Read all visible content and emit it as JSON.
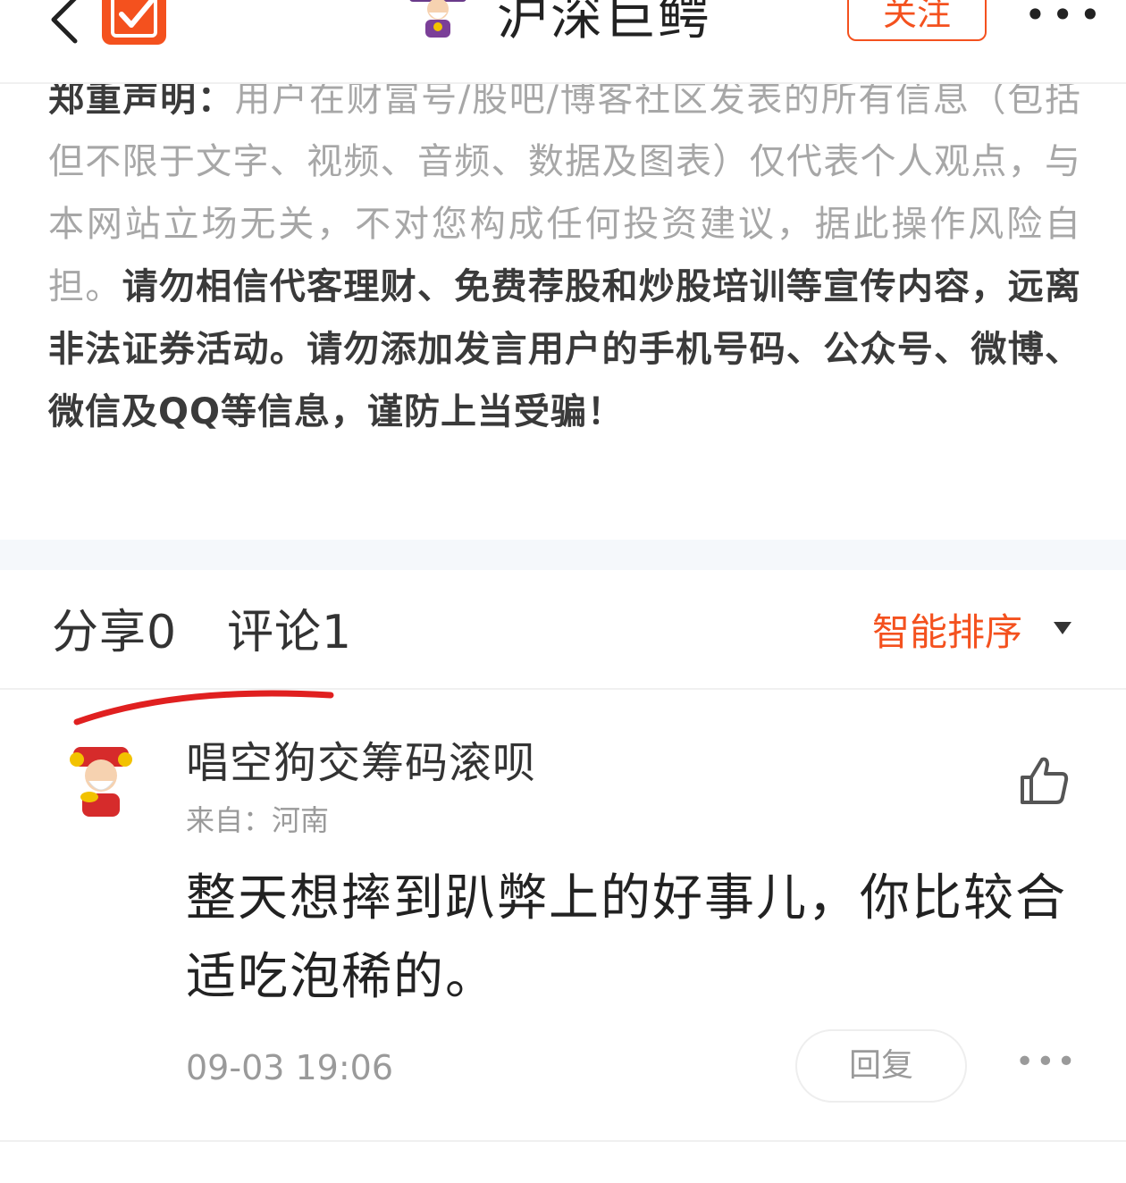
{
  "header": {
    "title": "沪深巨鳄",
    "follow_label": "关注",
    "more_label": "•••",
    "back_icon": "chevron-left-icon",
    "logo_icon": "checkmark-logo-icon",
    "accent_color": "#f4511e"
  },
  "disclaimer": {
    "heading": "郑重声明：",
    "gray_text": "用户在财富号/股吧/博客社区发表的所有信息（包括但不限于文字、视频、音频、数据及图表）仅代表个人观点，与本网站立场无关，不对您构成任何投资建议，据此操作风险自担。",
    "bold_text": "请勿相信代客理财、免费荐股和炒股培训等宣传内容，远离非法证券活动。请勿添加发言用户的手机号码、公众号、微博、微信及QQ等信息，谨防上当受骗！"
  },
  "tabs": {
    "share_label": "分享",
    "share_count": "0",
    "comment_label": "评论",
    "comment_count": "1",
    "sort_label": "智能排序",
    "sort_icon": "caret-down-icon"
  },
  "comment": {
    "username": "唱空狗交筹码滚呗",
    "location": "来自：河南",
    "text": "整天想摔到趴弊上的好事儿，你比较合适吃泡稀的。",
    "time": "09-03 19:06",
    "reply_label": "回复",
    "more_label": "•••",
    "like_icon": "thumbs-up-icon"
  }
}
